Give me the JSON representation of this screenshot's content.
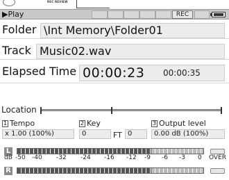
{
  "banner": {
    "text": "REC REVIEW"
  },
  "status": {
    "mode_icon": "play-triangle-icon",
    "mode_label": "Play",
    "rec_label": "REC",
    "battery_icon": "battery-icon"
  },
  "folder": {
    "label": "Folder",
    "value": "\\Int Memory\\Folder01"
  },
  "track": {
    "label": "Track",
    "value": "Music02.wav"
  },
  "time": {
    "label": "Elapsed Time",
    "elapsed": "00:00:23",
    "total": "00:00:35"
  },
  "location": {
    "label": "Location",
    "position_fraction": 0.39
  },
  "params": {
    "tempo": {
      "num": "1",
      "title": "Tempo",
      "value": "x 1.00 (100%)"
    },
    "key": {
      "num": "2",
      "title": "Key",
      "value": "0",
      "ft_label": "FT",
      "ft_value": "0"
    },
    "output": {
      "num": "3",
      "title": "Output level",
      "value": "0.00 dB (100%)"
    }
  },
  "meters": {
    "left_label": "L",
    "right_label": "R",
    "left_level": 0.72,
    "right_level": 0.72,
    "scale_unit": "dB",
    "scale_ticks": [
      "-50",
      "-40",
      "-32",
      "-24",
      "-16",
      "-12",
      "-9",
      "-6",
      "-3",
      "0"
    ],
    "over_label": "OVER"
  }
}
